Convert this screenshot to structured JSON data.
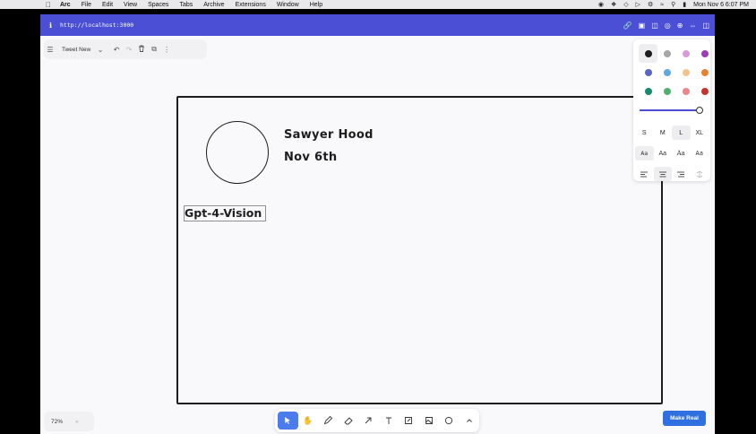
{
  "menubar": {
    "app": "Arc",
    "items": [
      "File",
      "Edit",
      "View",
      "Spaces",
      "Tabs",
      "Archive",
      "Extensions",
      "Window",
      "Help"
    ],
    "clock": "Mon Nov 6  6:07 PM"
  },
  "browser": {
    "url": "http://localhost:3000",
    "accent": "#4b4fd6"
  },
  "top_menu": {
    "page_name": "Tweet New"
  },
  "style_panel": {
    "colors": [
      "#1d1d1d",
      "#a6a6a6",
      "#d69cd8",
      "#9a3fb7",
      "#5b64c9",
      "#5ea9dd",
      "#f2c38f",
      "#e5822d",
      "#178a6d",
      "#4fb06e",
      "#e7878a",
      "#c8322d"
    ],
    "sizes": [
      "S",
      "M",
      "L",
      "XL"
    ],
    "selected_size": "L",
    "fonts": [
      "Aa",
      "Aa",
      "Aa",
      "Aa"
    ]
  },
  "canvas": {
    "name": "Sawyer Hood",
    "date": "Nov 6th",
    "label": "Gpt-4-Vision"
  },
  "footer": {
    "zoom": "72%",
    "make_real": "Make Real"
  }
}
